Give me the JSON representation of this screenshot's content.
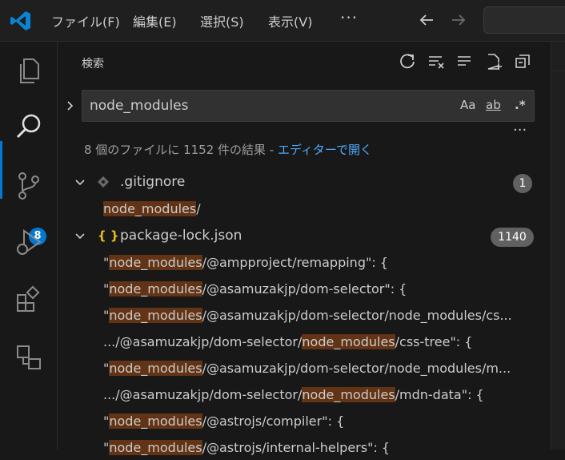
{
  "titlebar": {
    "menus": [
      "ファイル(F)",
      "編集(E)",
      "選択(S)",
      "表示(V)"
    ],
    "more": "···"
  },
  "activitybar": {
    "items": [
      "explorer-icon",
      "search-icon",
      "source-control-icon",
      "run-debug-icon",
      "extensions-icon",
      "remote-explorer-icon"
    ],
    "scm_badge": "8"
  },
  "sidebar": {
    "title": "検索",
    "search": {
      "value": "node_modules",
      "options": {
        "match_case": "Aa",
        "whole_word": "ab",
        "regex": ".*"
      }
    },
    "more": "···",
    "summary_text": "8 個のファイルに 1152 件の結果 - ",
    "summary_link": "エディターで開く",
    "files": [
      {
        "name": ".gitignore",
        "count": "1",
        "icon": "git-file-icon",
        "matches": [
          {
            "pre": "",
            "hit": "node_modules",
            "post": "/"
          }
        ]
      },
      {
        "name": "package-lock.json",
        "count": "1140",
        "icon": "json-file-icon",
        "icon_glyph": "{ }",
        "matches": [
          {
            "pre": "\"",
            "hit": "node_modules",
            "post": "/@ampproject/remapping\": {"
          },
          {
            "pre": "\"",
            "hit": "node_modules",
            "post": "/@asamuzakjp/dom-selector\": {"
          },
          {
            "pre": "\"",
            "hit": "node_modules",
            "post": "/@asamuzakjp/dom-selector/node_modules/cs..."
          },
          {
            "pre": ".../@asamuzakjp/dom-selector/",
            "hit": "node_modules",
            "post": "/css-tree\": {"
          },
          {
            "pre": "\"",
            "hit": "node_modules",
            "post": "/@asamuzakjp/dom-selector/node_modules/m..."
          },
          {
            "pre": ".../@asamuzakjp/dom-selector/",
            "hit": "node_modules",
            "post": "/mdn-data\": {"
          },
          {
            "pre": "\"",
            "hit": "node_modules",
            "post": "/@astrojs/compiler\": {"
          },
          {
            "pre": "\"",
            "hit": "node_modules",
            "post": "/@astrojs/internal-helpers\": {"
          }
        ]
      }
    ]
  },
  "colors": {
    "accent": "#0078d4",
    "highlight": "#623315",
    "link": "#4daafc",
    "json_icon": "#e8c11c"
  }
}
